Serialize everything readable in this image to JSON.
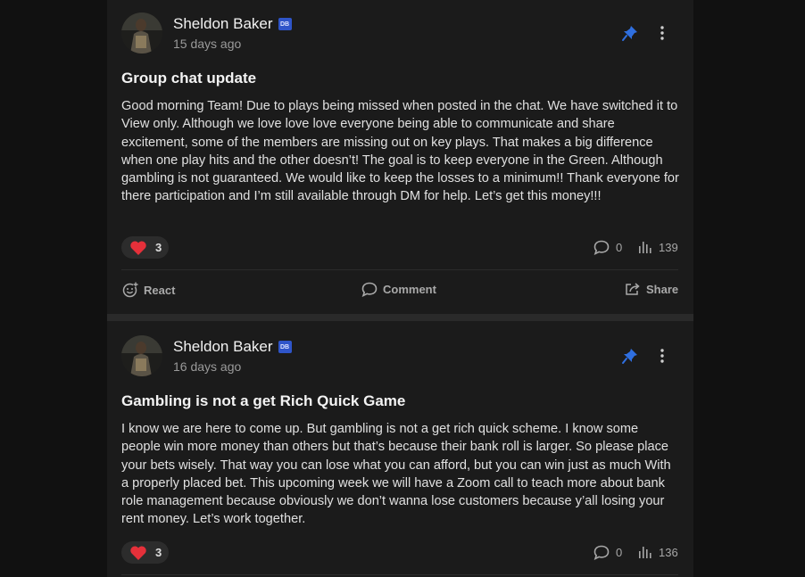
{
  "posts": [
    {
      "author": "Sheldon Baker",
      "badge": "DB",
      "time": "15 days ago",
      "title": "Group chat update",
      "body": "Good morning Team! Due to plays being missed when posted in the chat. We have switched it to View only. Although we love love love everyone being able to communicate and share excitement, some of the members are missing out on key plays. That makes a big difference when one play hits and the other doesn’t! The goal is to keep everyone in the Green. Although gambling is not guaranteed. We would like to keep the losses to a minimum!! Thank everyone for there participation and I’m still available through DM for help. Let’s get this money!!!",
      "reaction_count": "3",
      "comments": "0",
      "views": "139",
      "actions": {
        "react": "React",
        "comment": "Comment",
        "share": "Share"
      }
    },
    {
      "author": "Sheldon Baker",
      "badge": "DB",
      "time": "16 days ago",
      "title": "Gambling is not a get Rich Quick Game",
      "body": "I know we are here to come up. But gambling is not a get rich quick scheme. I know some people win more money than others but that’s because their bank roll is larger. So please place your bets wisely. That way you can lose what you can afford, but you can win just as much With a properly placed bet. This upcoming week we will have a Zoom call to teach more about bank role management because obviously we don’t wanna lose customers because y’all losing your rent money. Let’s work together.",
      "reaction_count": "3",
      "comments": "0",
      "views": "136"
    }
  ],
  "icons": {
    "reaction": "heart-icon",
    "pin": "pin-icon",
    "menu": "more-vertical-icon",
    "comments": "speech-bubble-icon",
    "views": "bar-chart-icon",
    "react": "add-emoji-icon",
    "share": "share-icon"
  },
  "colors": {
    "pin": "#2f6fe0",
    "heart": "#e5303a",
    "badge": "#2f55c9"
  }
}
